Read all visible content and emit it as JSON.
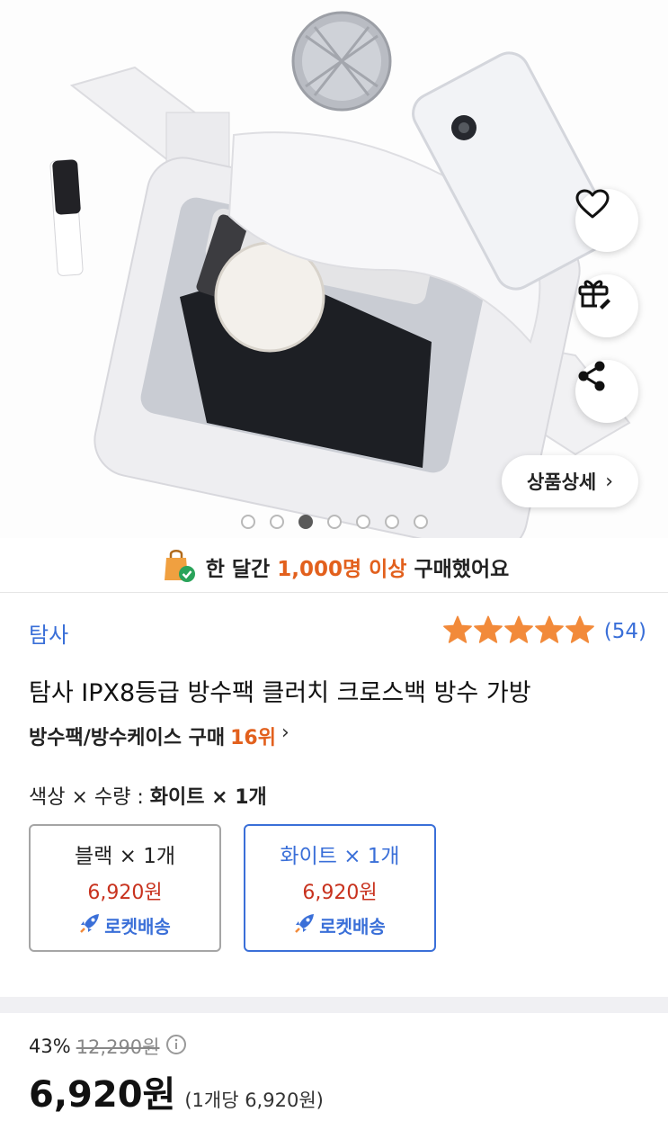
{
  "hero": {
    "gallery_total": 7,
    "gallery_active_index": 3,
    "detail_button_label": "상품상세",
    "detail_button_chevron": "›"
  },
  "banner": {
    "prefix": "한 달간 ",
    "highlight": "1,000명 이상",
    "suffix": " 구매했어요"
  },
  "product": {
    "brand": "탐사",
    "rating_stars": 5,
    "review_count": "(54)",
    "title": "탐사 IPX8등급 방수팩 클러치 크로스백 방수 가방",
    "rank_category": "방수팩/방수케이스 구매",
    "rank_number": "16위",
    "rank_chevron": "›"
  },
  "options": {
    "label_prefix": "색상 × 수량 : ",
    "label_value": "화이트 × 1개",
    "cards": [
      {
        "name": "블랙 × 1개",
        "price": "6,920원",
        "delivery": "로켓배송",
        "selected": false
      },
      {
        "name": "화이트 × 1개",
        "price": "6,920원",
        "delivery": "로켓배송",
        "selected": true
      }
    ]
  },
  "pricing": {
    "discount": "43%",
    "original_price": "12,290원",
    "sale_price": "6,920원",
    "unit_price": "(1개당 6,920원)"
  },
  "colors": {
    "accent_blue": "#3a6fd8",
    "highlight_orange": "#e2601d",
    "price_red": "#c8321e",
    "star_orange": "#f28a3a"
  },
  "icons": [
    "heart-icon",
    "gift-icon",
    "share-icon",
    "shopping-bag-icon",
    "star-icon",
    "rocket-icon",
    "info-icon"
  ]
}
